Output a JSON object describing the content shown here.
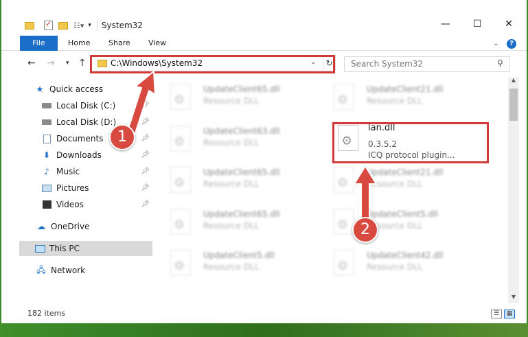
{
  "window": {
    "title": "System32",
    "controls": {
      "minimize": "—",
      "maximize": "☐",
      "close": "✕"
    }
  },
  "ribbon": {
    "tabs": [
      "File",
      "Home",
      "Share",
      "View"
    ],
    "help": "?"
  },
  "nav": {
    "address": "C:\\Windows\\System32",
    "search_placeholder": "Search System32"
  },
  "sidebar": {
    "quick_access": "Quick access",
    "items": [
      {
        "label": "Local Disk (C:)",
        "icon": "drive-icon"
      },
      {
        "label": "Local Disk (D:)",
        "icon": "drive-icon"
      },
      {
        "label": "Documents",
        "icon": "documents-icon"
      },
      {
        "label": "Downloads",
        "icon": "downloads-icon"
      },
      {
        "label": "Music",
        "icon": "music-icon"
      },
      {
        "label": "Pictures",
        "icon": "pictures-icon"
      },
      {
        "label": "Videos",
        "icon": "videos-icon"
      }
    ],
    "onedrive": "OneDrive",
    "this_pc": "This PC",
    "network": "Network"
  },
  "files": {
    "left": [
      {
        "name": "UpdateClient65.dll",
        "desc": "Resource DLL"
      },
      {
        "name": "UpdateClient63.dll",
        "desc": "Resource DLL"
      },
      {
        "name": "UpdateClient65.dll",
        "desc": "Resource DLL"
      },
      {
        "name": "UpdateClient65.dll",
        "desc": "Resource DLL"
      },
      {
        "name": "UpdateClient5.dll",
        "desc": "Resource DLL"
      }
    ],
    "right": [
      {
        "name": "UpdateClient21.dll",
        "desc": "Resource DLL"
      },
      {
        "name": "UpdateClient21.dll",
        "desc": "Resource DLL"
      },
      {
        "name": "UpdateClient5.dll",
        "desc": "Resource DLL"
      },
      {
        "name": "UpdateClient42.dll",
        "desc": "Resource DLL"
      }
    ],
    "highlighted": {
      "name": "lan.dll",
      "version": "0.3.5.2",
      "desc": "ICQ protocol plugin..."
    }
  },
  "status": {
    "count": "182 items"
  },
  "callouts": [
    "1",
    "2"
  ],
  "colors": {
    "accent": "#1a6ec7",
    "highlight": "#d23a3a",
    "callout": "#d84a3f"
  }
}
